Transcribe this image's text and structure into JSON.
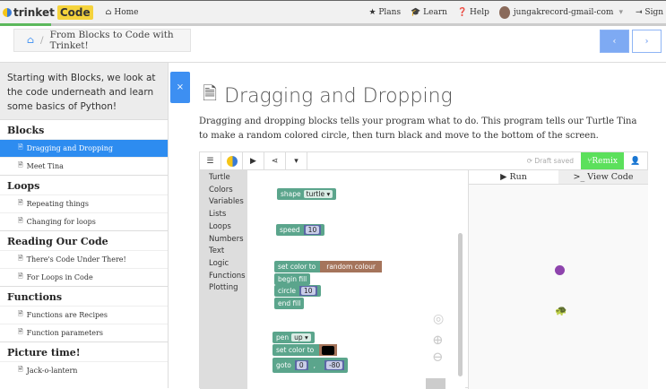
{
  "topnav": {
    "brand": "trinket",
    "brand_badge": "Code",
    "home": "Home",
    "plans": "Plans",
    "learn": "Learn",
    "help": "Help",
    "user": "jungakrecord-gmail-com",
    "signout": "Sign Out"
  },
  "progress_percent": 8,
  "breadcrumb": {
    "title": "From Blocks to Code with Trinket!",
    "separator": "/"
  },
  "pager": {
    "prev": "‹",
    "next": "›"
  },
  "sidebar": {
    "intro": "Starting with Blocks, we look at the code underneath and learn some basics of Python!",
    "sections": [
      {
        "title": "Blocks",
        "items": [
          "Dragging and Dropping",
          "Meet Tina"
        ]
      },
      {
        "title": "Loops",
        "items": [
          "Repeating things",
          "Changing for loops"
        ]
      },
      {
        "title": "Reading Our Code",
        "items": [
          "There's Code Under There!",
          "For Loops in Code"
        ]
      },
      {
        "title": "Functions",
        "items": [
          "Functions are Recipes",
          "Function parameters"
        ]
      },
      {
        "title": "Picture time!",
        "items": [
          "Jack-o-lantern"
        ]
      }
    ],
    "active": "Dragging and Dropping"
  },
  "close_label": "×",
  "page": {
    "title": "Dragging and Dropping",
    "description": "Dragging and dropping blocks tells your program what to do. This program tells our Turtle Tina to make a random colored circle, then turn black and move to the bottom of the screen."
  },
  "editor": {
    "draft_status": "Draft saved",
    "remix": "Remix",
    "run_tab": "Run",
    "code_tab": "View Code",
    "categories": [
      "Turtle",
      "Colors",
      "Variables",
      "Lists",
      "Loops",
      "Numbers",
      "Text",
      "Logic",
      "Functions",
      "Plotting"
    ],
    "blocks": {
      "shape": "shape",
      "shape_val": "turtle",
      "speed": "speed",
      "speed_val": "10",
      "set_color": "set color to",
      "random_colour": "random colour",
      "begin_fill": "begin fill",
      "circle": "circle",
      "circle_val": "10",
      "end_fill": "end fill",
      "pen": "pen",
      "pen_val": "up",
      "goto": "goto",
      "goto_x": "0",
      "goto_comma": ",",
      "goto_y": "-80"
    },
    "colors": {
      "circle": "#8e44ad",
      "turtle_block": "#5ba58c",
      "number_block": "#5b67a5",
      "color_block": "#a5745b",
      "remix": "#5ce05c"
    }
  }
}
